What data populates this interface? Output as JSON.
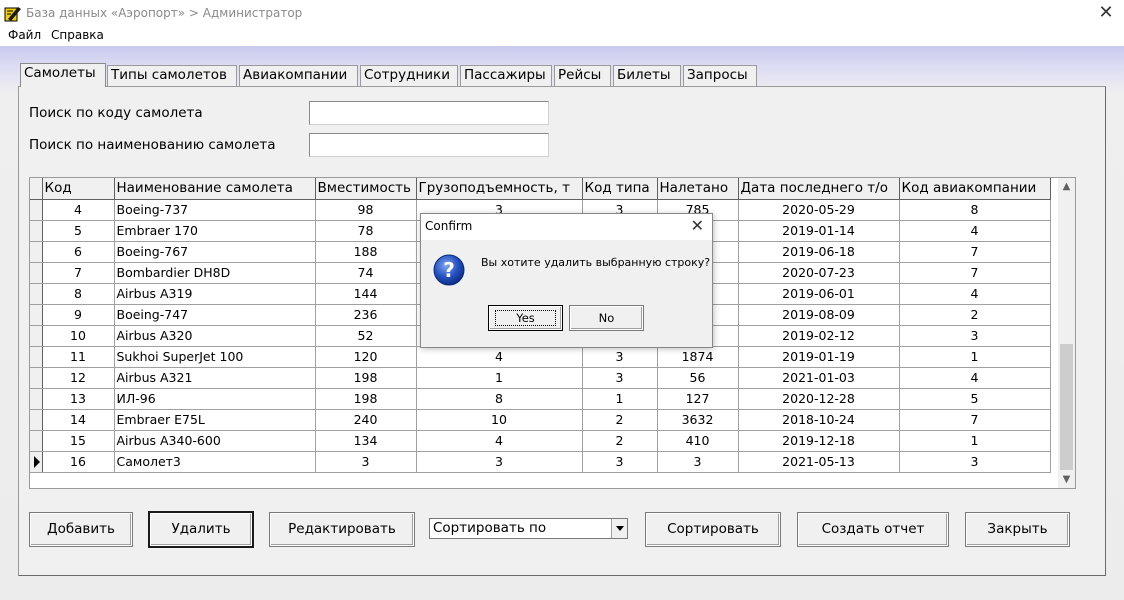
{
  "window": {
    "title": "База данных «Аэропорт» > Администратор",
    "close_glyph": "✕"
  },
  "menu": [
    "Файл",
    "Справка"
  ],
  "tabs": [
    "Самолеты",
    "Типы самолетов",
    "Авиакомпании",
    "Сотрудники",
    "Пассажиры",
    "Рейсы",
    "Билеты",
    "Запросы"
  ],
  "search": {
    "by_code_label": "Поиск по коду самолета",
    "by_code_value": "",
    "by_name_label": "Поиск по наименованию самолета",
    "by_name_value": ""
  },
  "grid": {
    "columns": [
      "Код",
      "Наименование самолета",
      "Вместимость",
      "Грузоподъемность, т",
      "Код типа",
      "Налетано",
      "Дата последнего т/о",
      "Код авиакомпании"
    ],
    "rows": [
      [
        "4",
        "Boeing-737",
        "98",
        "3",
        "3",
        "785",
        "2020-05-29",
        "8"
      ],
      [
        "5",
        "Embraer 170",
        "78",
        "",
        "",
        "",
        "2019-01-14",
        "4"
      ],
      [
        "6",
        "Boeing-767",
        "188",
        "",
        "",
        "",
        "2019-06-18",
        "7"
      ],
      [
        "7",
        "Bombardier DH8D",
        "74",
        "",
        "",
        "",
        "2020-07-23",
        "7"
      ],
      [
        "8",
        "Airbus A319",
        "144",
        "",
        "",
        "",
        "2019-06-01",
        "4"
      ],
      [
        "9",
        "Boeing-747",
        "236",
        "",
        "",
        "",
        "2019-08-09",
        "2"
      ],
      [
        "10",
        "Airbus A320",
        "52",
        "",
        "",
        "",
        "2019-02-12",
        "3"
      ],
      [
        "11",
        "Sukhoi SuperJet 100",
        "120",
        "4",
        "3",
        "1874",
        "2019-01-19",
        "1"
      ],
      [
        "12",
        "Airbus A321",
        "198",
        "1",
        "3",
        "56",
        "2021-01-03",
        "4"
      ],
      [
        "13",
        "ИЛ-96",
        "198",
        "8",
        "1",
        "127",
        "2020-12-28",
        "5"
      ],
      [
        "14",
        "Embraer E75L",
        "240",
        "10",
        "2",
        "3632",
        "2018-10-24",
        "7"
      ],
      [
        "15",
        "Airbus A340-600",
        "134",
        "4",
        "2",
        "410",
        "2019-12-18",
        "1"
      ],
      [
        "16",
        "Самолет3",
        "3",
        "3",
        "3",
        "3",
        "2021-05-13",
        "3"
      ]
    ],
    "current_row": "16"
  },
  "buttons": {
    "add": "Добавить",
    "delete": "Удалить",
    "edit": "Редактировать",
    "sort_select": "Сортировать по",
    "sort": "Сортировать",
    "report": "Создать отчет",
    "close": "Закрыть"
  },
  "dialog": {
    "title": "Confirm",
    "message": "Вы хотите удалить выбранную строку?",
    "yes": "Yes",
    "no": "No",
    "icon": "question-icon"
  }
}
